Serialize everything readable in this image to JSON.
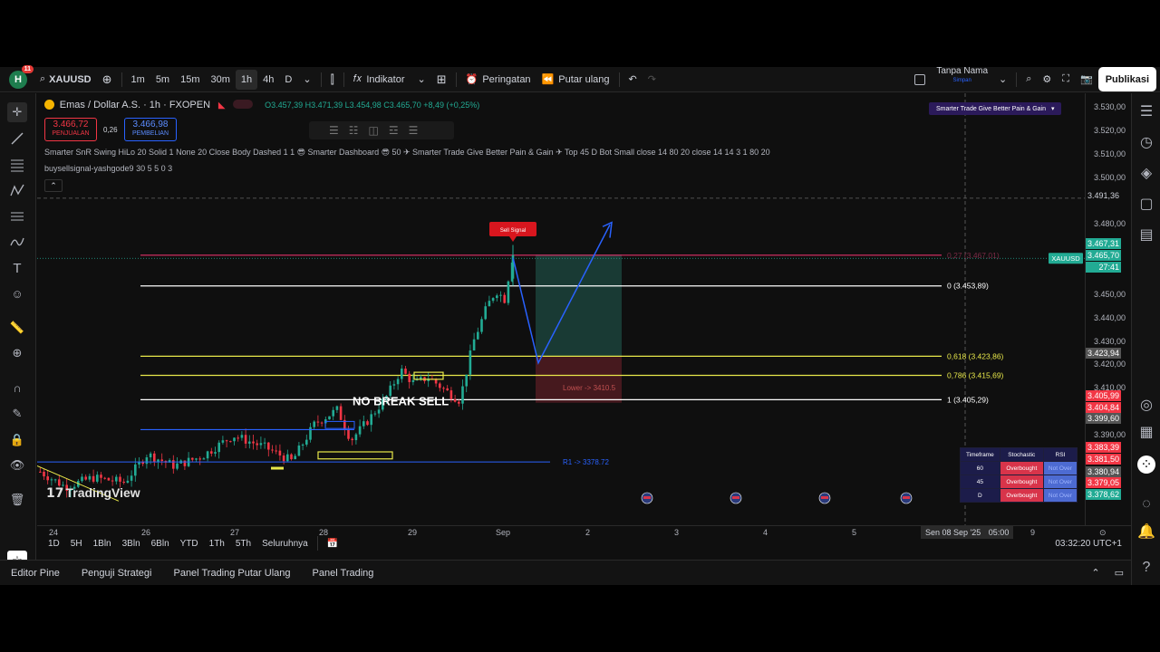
{
  "topbar": {
    "avatar_letter": "H",
    "notification_count": "11",
    "symbol": "XAUUSD",
    "timeframes": [
      "1m",
      "5m",
      "15m",
      "30m",
      "1h",
      "4h",
      "D"
    ],
    "active_timeframe": "1h",
    "indicators_label": "Indikator",
    "alerts_label": "Peringatan",
    "replay_label": "Putar ulang",
    "account_name": "Tanpa Nama",
    "account_sub": "Simpan",
    "publish_label": "Publikasi"
  },
  "chart_header": {
    "title": "Emas / Dollar A.S. · 1h · FXOPEN",
    "ohlc": "O3.457,39  H3.471,39  L3.454,98  C3.465,70  +8,49 (+0,25%)",
    "sell_price": "3.466,72",
    "sell_label": "PENJUALAN",
    "spread": "0,26",
    "buy_price": "3.466,98",
    "buy_label": "PEMBELIAN",
    "indicator_line_1": "Smarter SnR Swing HiLo 20 Solid 1 None 20 Close Body Dashed 1 1 😎 Smarter Dashboard 😎 50 ✈ Smarter Trade Give Better Pain & Gain ✈ Top 45 D Bot Small close 14 80 20 close 14 14 3 1 80 20",
    "indicator_line_2": "buysellsignal-yashgode9 30 5 5 0 3",
    "top_right_badge": "Smarter Trade Give Better Pain & Gain"
  },
  "chart_data": {
    "type": "candlestick",
    "symbol": "XAUUSD",
    "last_price": 3465.7,
    "ylim": [
      3370,
      3535
    ],
    "yticks": [
      "3.530,00",
      "3.520,00",
      "3.510,00",
      "3.500,00",
      "3.480,00",
      "3.450,00",
      "3.440,00",
      "3.430,00",
      "3.420,00",
      "3.410,00",
      "3.390,00"
    ],
    "xticks": [
      "24",
      "26",
      "27",
      "28",
      "29",
      "Sep",
      "2",
      "3",
      "4",
      "5",
      "9"
    ],
    "fib_levels": [
      {
        "label": "0,27 (3.467,01)",
        "price": 3467.01,
        "color": "#e0316a"
      },
      {
        "label": "0 (3.453,89)",
        "price": 3453.89,
        "color": "#ffffff"
      },
      {
        "label": "0,618 (3.423,86)",
        "price": 3423.86,
        "color": "#e8e84a"
      },
      {
        "label": "0,786 (3.415,69)",
        "price": 3415.69,
        "color": "#e8e84a"
      },
      {
        "label": "1 (3.405,29)",
        "price": 3405.29,
        "color": "#ffffff"
      }
    ],
    "annotations": {
      "no_break_sell": "NO BREAK SELL",
      "lower_label": "Lower -> 3410.5",
      "r1_label": "R1 -> 3378.72",
      "sell_signal": "Sell Signal"
    },
    "price_tags": [
      {
        "label": "XAUUSD",
        "value": "3.467,31",
        "color": "#22ab94"
      },
      {
        "label": "",
        "value": "3.465,70",
        "color": "#22ab94"
      },
      {
        "label": "",
        "value": "27:41",
        "color": "#22ab94"
      },
      {
        "label": "",
        "value": "3.491,36",
        "color": "#2a2a2a"
      },
      {
        "label": "",
        "value": "3.423,94",
        "color": "#555555"
      },
      {
        "label": "",
        "value": "3.405,99",
        "color": "#f23645"
      },
      {
        "label": "",
        "value": "3.404,84",
        "color": "#f23645"
      },
      {
        "label": "",
        "value": "3.399,60",
        "color": "#555555"
      },
      {
        "label": "",
        "value": "3.383,39",
        "color": "#f23645"
      },
      {
        "label": "",
        "value": "3.381,50",
        "color": "#f23645"
      },
      {
        "label": "",
        "value": "3.380,94",
        "color": "#555555"
      },
      {
        "label": "",
        "value": "3.379,05",
        "color": "#f23645"
      },
      {
        "label": "",
        "value": "3.378,62",
        "color": "#22ab94"
      }
    ],
    "crosshair_date": "Sen 08 Sep '25",
    "crosshair_time": "05:00"
  },
  "stochastic_table": {
    "headers": [
      "Timeframe",
      "Stochastic",
      "RSI"
    ],
    "rows": [
      {
        "tf": "60",
        "stoch": "Overbought",
        "rsi": "Not Over"
      },
      {
        "tf": "45",
        "stoch": "Overbought",
        "rsi": "Not Over"
      },
      {
        "tf": "D",
        "stoch": "Overbought",
        "rsi": "Not Over"
      }
    ]
  },
  "watermark": "TradingView",
  "rangebar": {
    "ranges": [
      "1D",
      "5H",
      "1Bln",
      "3Bln",
      "6Bln",
      "YTD",
      "1Th",
      "5Th",
      "Seluruhnya"
    ],
    "clock": "03:32:20 UTC+1"
  },
  "bottompanel": {
    "tabs": [
      "Editor Pine",
      "Penguji Strategi",
      "Panel Trading Putar Ulang",
      "Panel Trading"
    ]
  },
  "colors": {
    "up": "#22ab94",
    "down": "#f23645",
    "fib_red": "#e0316a",
    "fib_yellow": "#e8e84a",
    "projection": "#2962ff"
  }
}
